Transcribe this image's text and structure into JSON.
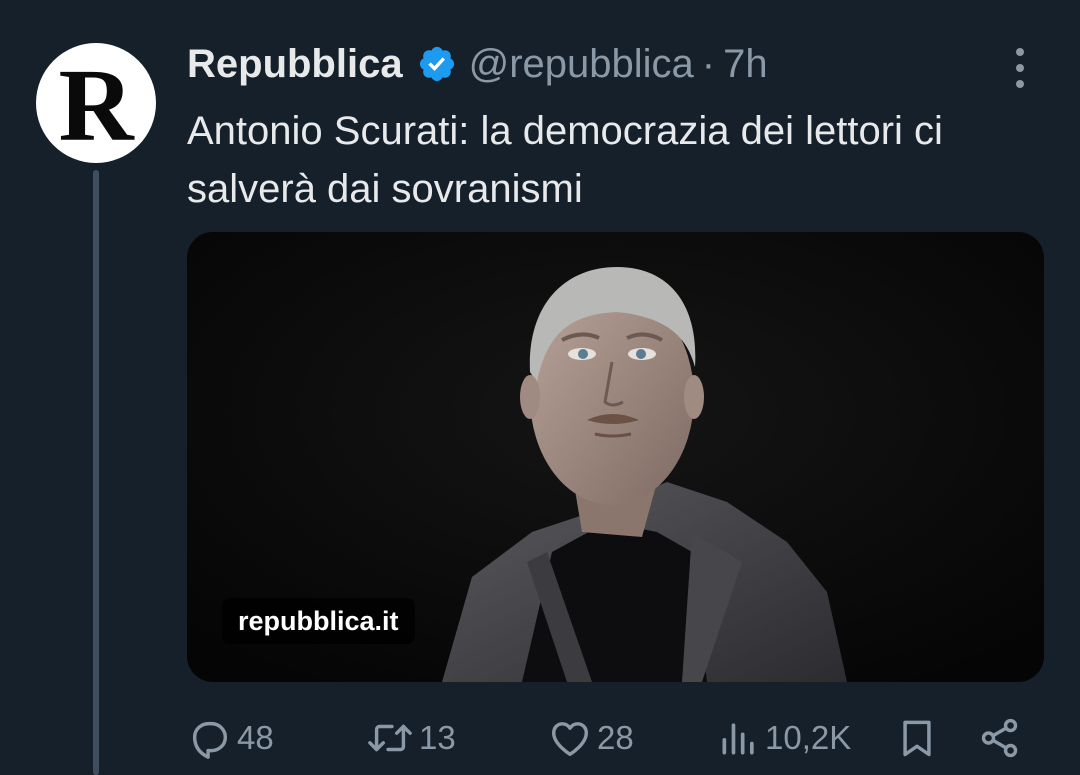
{
  "tweet": {
    "avatar_letter": "R",
    "display_name": "Repubblica",
    "verified_icon": "verified-badge-icon",
    "handle": "@repubblica",
    "separator": "·",
    "time": "7h",
    "more_icon": "more-options-icon",
    "text": "Antonio Scurati: la democrazia dei lettori ci salverà dai sovranismi",
    "card": {
      "domain": "repubblica.it"
    },
    "actions": {
      "reply": {
        "icon": "reply-icon",
        "count": "48"
      },
      "retweet": {
        "icon": "retweet-icon",
        "count": "13"
      },
      "like": {
        "icon": "heart-icon",
        "count": "28"
      },
      "views": {
        "icon": "views-icon",
        "count": "10,2K"
      },
      "bookmark": {
        "icon": "bookmark-icon"
      },
      "share": {
        "icon": "share-icon"
      }
    }
  },
  "colors": {
    "background": "#15202b",
    "text_primary": "#e7e9ea",
    "text_secondary": "#8b98a5",
    "verified_blue": "#1d9bf0"
  }
}
